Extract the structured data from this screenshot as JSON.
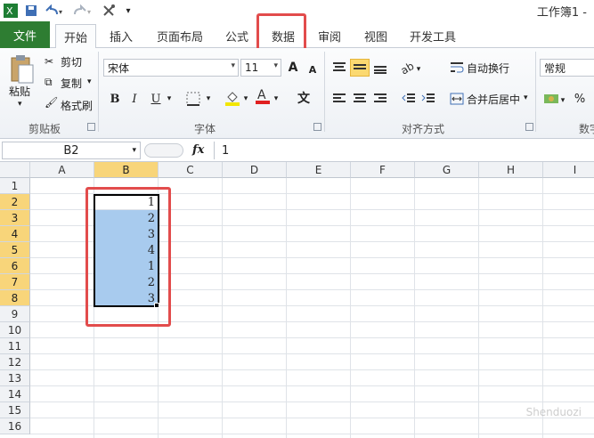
{
  "window": {
    "title": "工作簿1 -"
  },
  "qat": {
    "items": [
      "excel-logo",
      "save",
      "undo",
      "redo",
      "customize"
    ]
  },
  "tabs": [
    {
      "label": "文件"
    },
    {
      "label": "开始"
    },
    {
      "label": "插入"
    },
    {
      "label": "页面布局"
    },
    {
      "label": "公式"
    },
    {
      "label": "数据"
    },
    {
      "label": "审阅"
    },
    {
      "label": "视图"
    },
    {
      "label": "开发工具"
    }
  ],
  "ribbon": {
    "clipboard": {
      "paste": "粘贴",
      "cut": "剪切",
      "copy": "复制",
      "format_painter": "格式刷",
      "label": "剪贴板"
    },
    "font": {
      "name": "宋体",
      "size": "11",
      "label": "字体",
      "bold": "B",
      "italic": "I",
      "underline": "U",
      "grow": "A",
      "shrink": "A",
      "phonetic": "文"
    },
    "alignment": {
      "wrap": "自动换行",
      "merge": "合并后居中",
      "label": "对齐方式"
    },
    "number": {
      "format": "常规",
      "label": "数字",
      "percent": "%"
    }
  },
  "formula_bar": {
    "name_box": "B2",
    "fx": "fx",
    "value": "1"
  },
  "sheet": {
    "columns": [
      "A",
      "B",
      "C",
      "D",
      "E",
      "F",
      "G",
      "H",
      "I"
    ],
    "rows": [
      "1",
      "2",
      "3",
      "4",
      "5",
      "6",
      "7",
      "8",
      "9",
      "10",
      "11",
      "12",
      "13",
      "14",
      "15",
      "16"
    ],
    "b_values": [
      "1",
      "2",
      "3",
      "4",
      "1",
      "2",
      "3"
    ]
  },
  "colors": {
    "file_tab": "#2e7d32",
    "highlight": "#e24c4c",
    "selection": "#a8cbee",
    "header_selected": "#f8d57a"
  },
  "watermark": "Shenduozi"
}
